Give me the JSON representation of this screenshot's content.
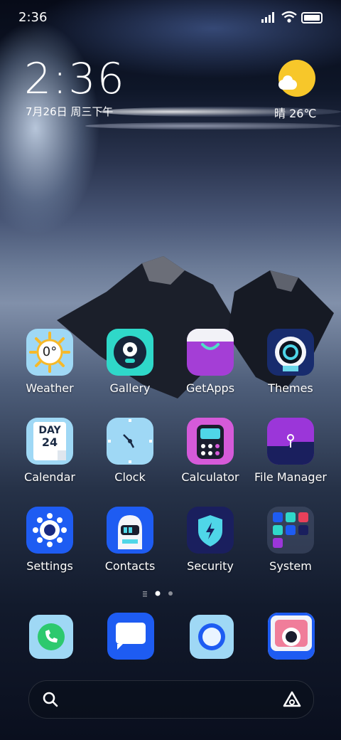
{
  "status_bar": {
    "time": "2:36"
  },
  "clock_widget": {
    "time": "2:36",
    "date": "7月26日 周三下午"
  },
  "weather_widget": {
    "text": "晴 26℃"
  },
  "apps": [
    {
      "label": "Weather",
      "icon": "weather-icon"
    },
    {
      "label": "Gallery",
      "icon": "gallery-icon"
    },
    {
      "label": "GetApps",
      "icon": "getapps-icon"
    },
    {
      "label": "Themes",
      "icon": "themes-icon"
    },
    {
      "label": "Calendar",
      "icon": "calendar-icon"
    },
    {
      "label": "Clock",
      "icon": "clock-icon"
    },
    {
      "label": "Calculator",
      "icon": "calculator-icon"
    },
    {
      "label": "File Manager",
      "icon": "file-manager-icon"
    },
    {
      "label": "Settings",
      "icon": "settings-icon"
    },
    {
      "label": "Contacts",
      "icon": "contacts-icon"
    },
    {
      "label": "Security",
      "icon": "security-icon"
    },
    {
      "label": "System",
      "icon": "system-folder-icon"
    }
  ],
  "weather_icon_text": "0°",
  "calendar_icon": {
    "top": "DAY",
    "num": "24"
  },
  "dock": [
    {
      "icon": "phone-icon"
    },
    {
      "icon": "messaging-icon"
    },
    {
      "icon": "browser-icon"
    },
    {
      "icon": "camera-icon"
    }
  ],
  "page_indicator": {
    "pages": 2,
    "current": 1
  },
  "colors": {
    "sun": "#f7c72a",
    "gallery_bg": "#2fd8c9",
    "getapps_bg": "#a43ed6",
    "settings_bg": "#1e5cf2"
  }
}
